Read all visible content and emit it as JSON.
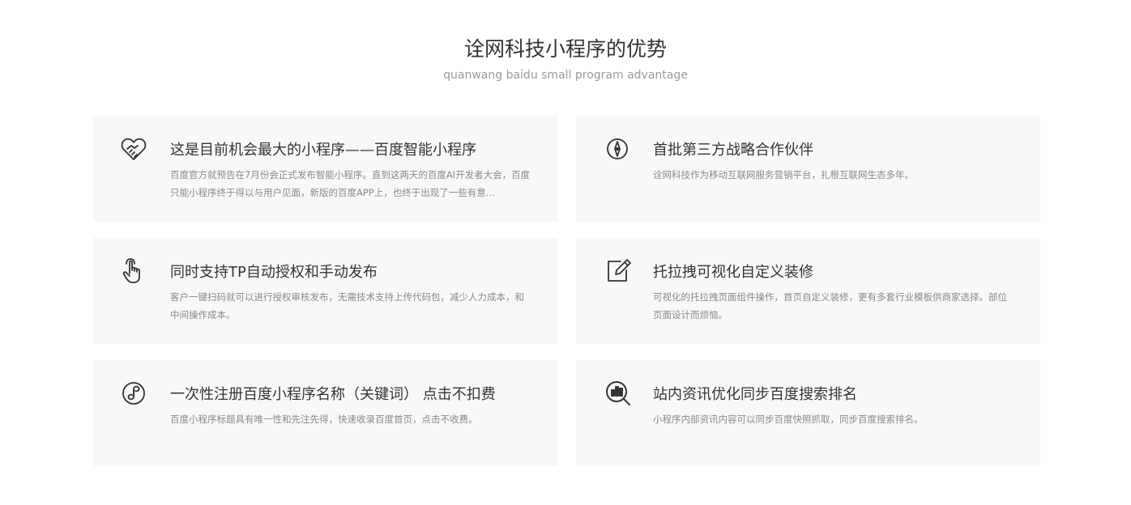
{
  "section": {
    "title": "诠网科技小程序的优势",
    "subtitle": "quanwang baidu small program advantage"
  },
  "cards": [
    {
      "icon": "handshake-heart-icon",
      "title": "这是目前机会最大的小程序——百度智能小程序",
      "desc": "百度官方就预告在7月份会正式发布智能小程序。直到这两天的百度AI开发者大会，百度只能小程序终于得以与用户见面，新版的百度APP上，也终于出现了一些有意..."
    },
    {
      "icon": "compass-icon",
      "title": "首批第三方战略合作伙伴",
      "desc": "诠网科技作为移动互联网服务营销平台，扎根互联网生态多年。"
    },
    {
      "icon": "hand-pointer-icon",
      "title": "同时支持TP自动授权和手动发布",
      "desc": "客户一键扫码就可以进行授权审核发布，无需技术支持上传代码包，减少人力成本，和中间操作成本。"
    },
    {
      "icon": "edit-icon",
      "title": "托拉拽可视化自定义装修",
      "desc": "可视化的托拉拽页面组件操作，首页自定义装修，更有多套行业模板供商家选择。部位页面设计而烦恼。"
    },
    {
      "icon": "link-circle-icon",
      "title": "一次性注册百度小程序名称（关键词） 点击不扣费",
      "desc": "百度小程序标题具有唯一性和先注先得，快速收录百度首页，点击不收费。"
    },
    {
      "icon": "chart-search-icon",
      "title": "站内资讯优化同步百度搜索排名",
      "desc": "小程序内部资讯内容可以同步百度快照抓取，同步百度搜索排名。"
    }
  ]
}
